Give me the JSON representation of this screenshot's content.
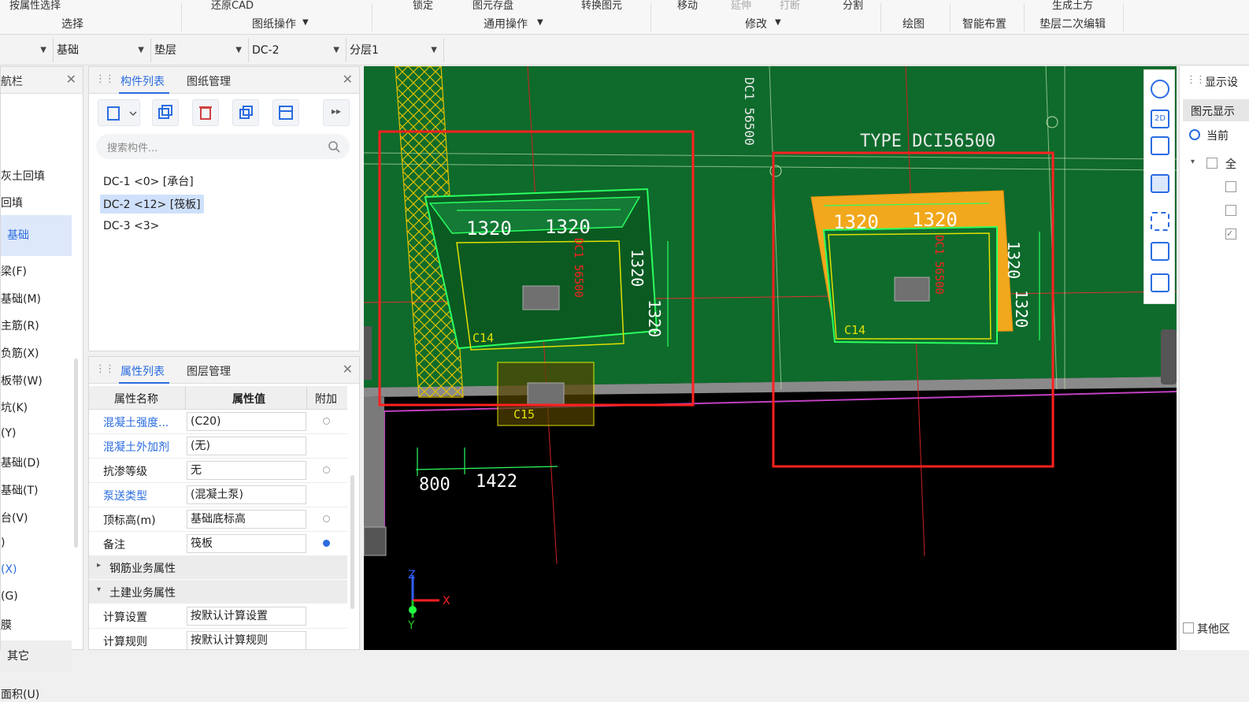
{
  "ribbon": {
    "top_fragments": [
      "按属性选择",
      "还原CAD",
      "锁定",
      "图元存盘",
      "转换图元",
      "移动",
      "延伸",
      "打断",
      "分割",
      "生成土方"
    ],
    "groups": [
      "选择",
      "图纸操作",
      "通用操作",
      "修改",
      "绘图",
      "智能布置",
      "垫层二次编辑"
    ]
  },
  "filterbar": {
    "selectors": [
      "基础",
      "垫层",
      "DC-2",
      "分层1"
    ]
  },
  "nav": {
    "title": "航栏",
    "items": [
      "灰土回填",
      "回填",
      "基础",
      "梁(F)",
      "基础(M)",
      "主筋(R)",
      "负筋(X)",
      "板带(W)",
      "坑(K)",
      "(Y)",
      "基础(D)",
      "基础(T)",
      "台(V)",
      ")",
      "(X)",
      "(G)",
      "膜",
      "其它",
      "面积(U)"
    ],
    "selected": "基础"
  },
  "components": {
    "tabs": [
      "构件列表",
      "图纸管理"
    ],
    "search_placeholder": "搜索构件...",
    "items": [
      "DC-1 <0> [承台]",
      "DC-2 <12> [筏板]",
      "DC-3 <3>"
    ],
    "selected_index": 1
  },
  "properties": {
    "tabs": [
      "属性列表",
      "图层管理"
    ],
    "headers": [
      "属性名称",
      "属性值",
      "附加"
    ],
    "rows": [
      {
        "name": "混凝土强度...",
        "value": "(C20)",
        "link": true,
        "dot": "grey"
      },
      {
        "name": "混凝土外加剂",
        "value": "(无)",
        "link": true,
        "dot": ""
      },
      {
        "name": "抗渗等级",
        "value": "无",
        "link": false,
        "dot": "grey"
      },
      {
        "name": "泵送类型",
        "value": "(混凝土泵)",
        "link": true,
        "dot": ""
      },
      {
        "name": "顶标高(m)",
        "value": "基础底标高",
        "link": false,
        "dot": "grey"
      },
      {
        "name": "备注",
        "value": "筏板",
        "link": false,
        "dot": "blue"
      }
    ],
    "groups": [
      "钢筋业务属性",
      "土建业务属性"
    ],
    "extra_rows": [
      {
        "name": "计算设置",
        "value": "按默认计算设置"
      },
      {
        "name": "计算规则",
        "value": "按默认计算规则"
      }
    ]
  },
  "cad": {
    "labels": {
      "top_text_1": "TYPE DCI56500",
      "vertical_text": "DC1 56500",
      "dim_1320": "1320",
      "label_c14": "C14",
      "label_c15": "C15",
      "dim_800": "800",
      "dim_1422": "1422",
      "axis_x": "X",
      "axis_y": "Y",
      "axis_z": "Z"
    },
    "colors": {
      "floor": "#0e6b2c",
      "selection": "#ff2020",
      "outline_green": "#2bff60",
      "outline_yellow": "#e0e000",
      "pad_orange": "#f2a81c"
    }
  },
  "rightpanel": {
    "title": "显示设",
    "subtab": "图元显示",
    "radio_label": "当前",
    "row_label": "全",
    "footer": "其他区"
  }
}
